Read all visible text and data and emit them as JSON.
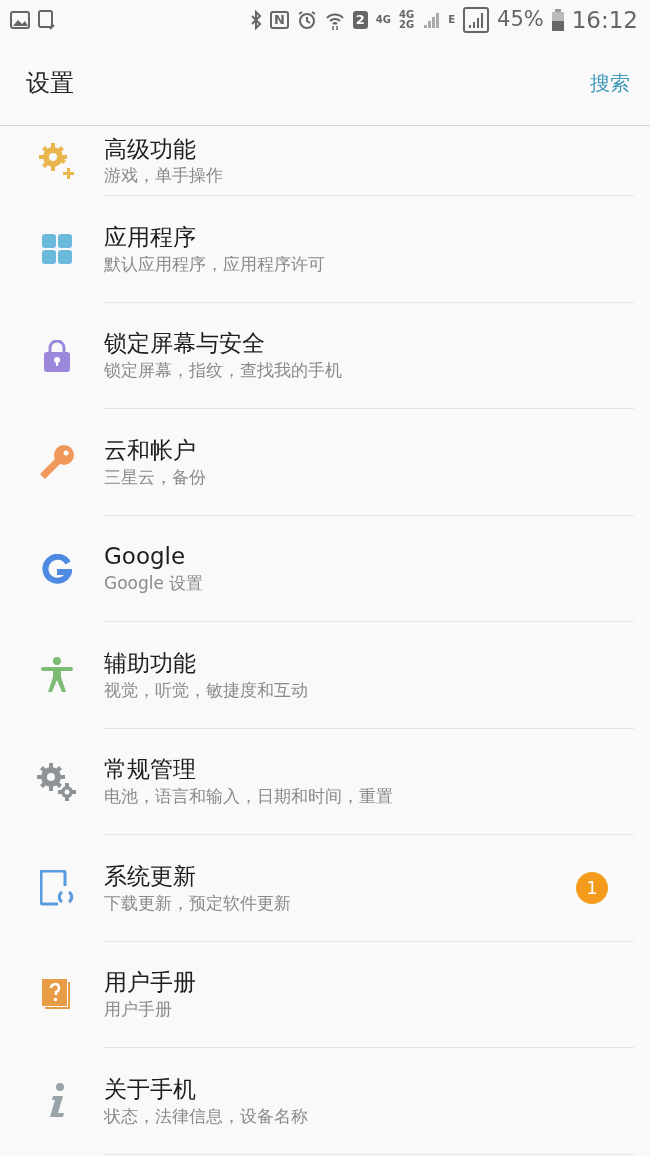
{
  "status_bar": {
    "nfc": "N",
    "sim": "2",
    "network_1": "4G",
    "network_2_top": "4G",
    "network_2_bottom": "2G",
    "network_3": "E",
    "battery": "45%",
    "time": "16:12"
  },
  "app_bar": {
    "title": "设置",
    "action": "搜索"
  },
  "items": [
    {
      "title": "高级功能",
      "subtitle": "游戏，单手操作",
      "color": "#e8b64c"
    },
    {
      "title": "应用程序",
      "subtitle": "默认应用程序，应用程序许可",
      "color": "#6bb8dc"
    },
    {
      "title": "锁定屏幕与安全",
      "subtitle": "锁定屏幕，指纹，查找我的手机",
      "color": "#9b87db"
    },
    {
      "title": "云和帐户",
      "subtitle": "三星云，备份",
      "color": "#f0975a"
    },
    {
      "title": "Google",
      "subtitle": "Google 设置",
      "color": "#4d8ae0"
    },
    {
      "title": "辅助功能",
      "subtitle": "视觉，听觉，敏捷度和互动",
      "color": "#7cbb74"
    },
    {
      "title": "常规管理",
      "subtitle": "电池，语言和输入，日期和时间，重置",
      "color": "#8d9396"
    },
    {
      "title": "系统更新",
      "subtitle": "下载更新，预定软件更新",
      "color": "#5a9be0",
      "badge": "1"
    },
    {
      "title": "用户手册",
      "subtitle": "用户手册",
      "color": "#e89c46"
    },
    {
      "title": "关于手机",
      "subtitle": "状态，法律信息，设备名称",
      "color": "#9aa3a8"
    }
  ]
}
